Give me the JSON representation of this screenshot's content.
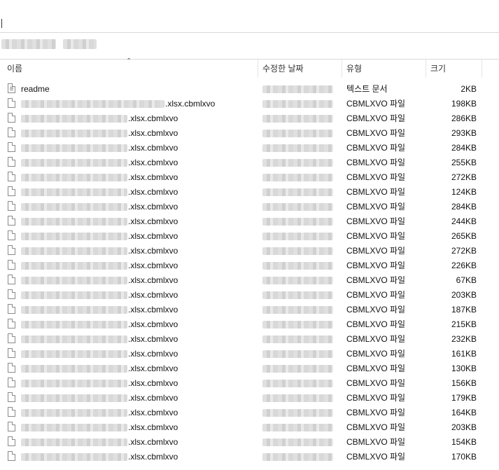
{
  "columns": {
    "name": "이름",
    "modified": "수정한 날짜",
    "type": "유형",
    "size": "크기"
  },
  "files": [
    {
      "name": "readme",
      "type": "텍스트 문서",
      "size": "2KB",
      "icon": "text-document-icon"
    },
    {
      "name": ".xlsx.cbmlxvo",
      "type": "CBMLXVO 파일",
      "size": "198KB",
      "icon": "file-icon"
    },
    {
      "name": ".xlsx.cbmlxvo",
      "type": "CBMLXVO 파일",
      "size": "286KB",
      "icon": "file-icon"
    },
    {
      "name": ".xlsx.cbmlxvo",
      "type": "CBMLXVO 파일",
      "size": "293KB",
      "icon": "file-icon"
    },
    {
      "name": ".xlsx.cbmlxvo",
      "type": "CBMLXVO 파일",
      "size": "284KB",
      "icon": "file-icon"
    },
    {
      "name": ".xlsx.cbmlxvo",
      "type": "CBMLXVO 파일",
      "size": "255KB",
      "icon": "file-icon"
    },
    {
      "name": ".xlsx.cbmlxvo",
      "type": "CBMLXVO 파일",
      "size": "272KB",
      "icon": "file-icon"
    },
    {
      "name": ".xlsx.cbmlxvo",
      "type": "CBMLXVO 파일",
      "size": "124KB",
      "icon": "file-icon"
    },
    {
      "name": ".xlsx.cbmlxvo",
      "type": "CBMLXVO 파일",
      "size": "284KB",
      "icon": "file-icon"
    },
    {
      "name": ".xlsx.cbmlxvo",
      "type": "CBMLXVO 파일",
      "size": "244KB",
      "icon": "file-icon"
    },
    {
      "name": ".xlsx.cbmlxvo",
      "type": "CBMLXVO 파일",
      "size": "265KB",
      "icon": "file-icon"
    },
    {
      "name": ".xlsx.cbmlxvo",
      "type": "CBMLXVO 파일",
      "size": "272KB",
      "icon": "file-icon"
    },
    {
      "name": ".xlsx.cbmlxvo",
      "type": "CBMLXVO 파일",
      "size": "226KB",
      "icon": "file-icon"
    },
    {
      "name": ".xlsx.cbmlxvo",
      "type": "CBMLXVO 파일",
      "size": "67KB",
      "icon": "file-icon"
    },
    {
      "name": ".xlsx.cbmlxvo",
      "type": "CBMLXVO 파일",
      "size": "203KB",
      "icon": "file-icon"
    },
    {
      "name": ".xlsx.cbmlxvo",
      "type": "CBMLXVO 파일",
      "size": "187KB",
      "icon": "file-icon"
    },
    {
      "name": ".xlsx.cbmlxvo",
      "type": "CBMLXVO 파일",
      "size": "215KB",
      "icon": "file-icon"
    },
    {
      "name": ".xlsx.cbmlxvo",
      "type": "CBMLXVO 파일",
      "size": "232KB",
      "icon": "file-icon"
    },
    {
      "name": ".xlsx.cbmlxvo",
      "type": "CBMLXVO 파일",
      "size": "161KB",
      "icon": "file-icon"
    },
    {
      "name": ".xlsx.cbmlxvo",
      "type": "CBMLXVO 파일",
      "size": "130KB",
      "icon": "file-icon"
    },
    {
      "name": ".xlsx.cbmlxvo",
      "type": "CBMLXVO 파일",
      "size": "156KB",
      "icon": "file-icon"
    },
    {
      "name": ".xlsx.cbmlxvo",
      "type": "CBMLXVO 파일",
      "size": "179KB",
      "icon": "file-icon"
    },
    {
      "name": ".xlsx.cbmlxvo",
      "type": "CBMLXVO 파일",
      "size": "164KB",
      "icon": "file-icon"
    },
    {
      "name": ".xlsx.cbmlxvo",
      "type": "CBMLXVO 파일",
      "size": "203KB",
      "icon": "file-icon"
    },
    {
      "name": ".xlsx.cbmlxvo",
      "type": "CBMLXVO 파일",
      "size": "154KB",
      "icon": "file-icon"
    },
    {
      "name": ".xlsx.cbmlxvo",
      "type": "CBMLXVO 파일",
      "size": "170KB",
      "icon": "file-icon"
    }
  ]
}
